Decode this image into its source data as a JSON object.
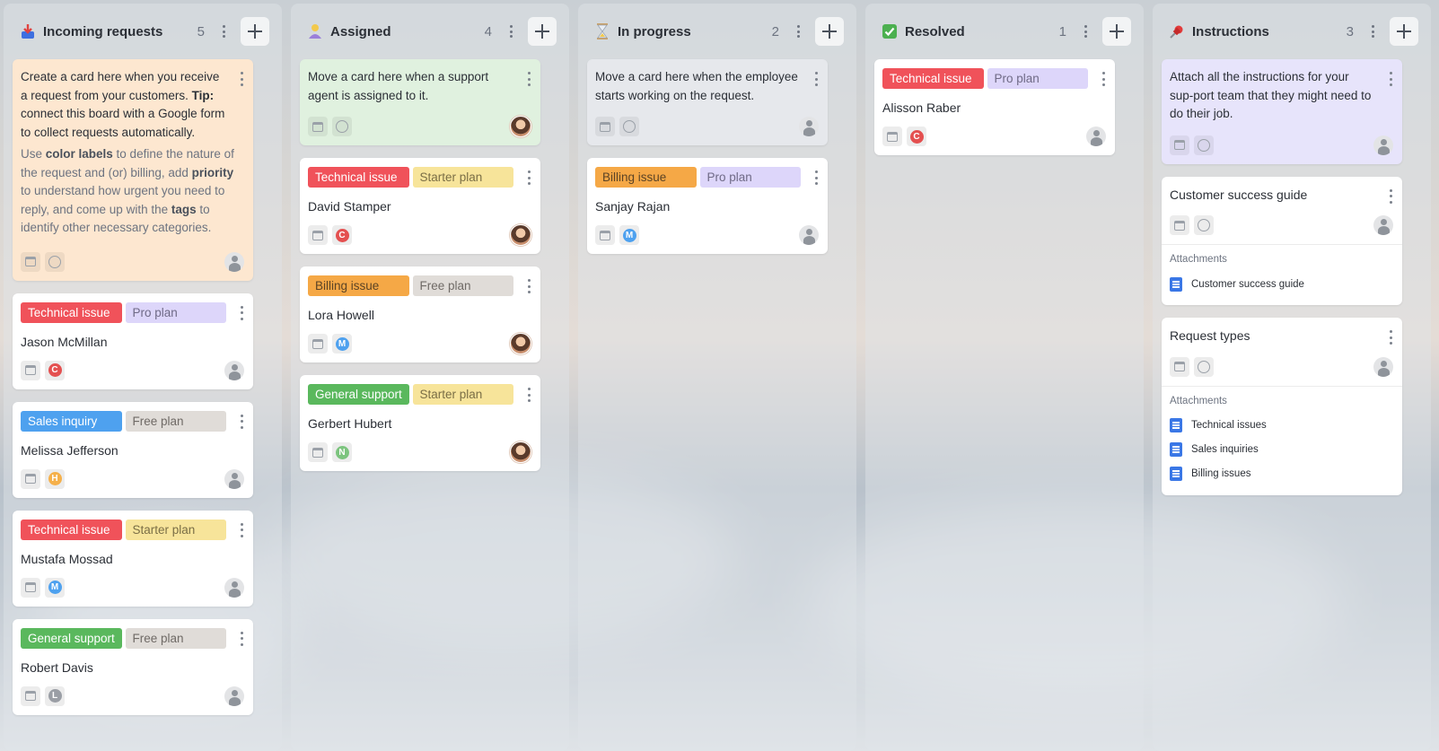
{
  "colors": {
    "technical": "#f0525a",
    "sales": "#4ea1ef",
    "billing": "#f5a846",
    "general": "#5ab85d",
    "pro": "#ddd6fa",
    "free": "#e0dcd8",
    "starter": "#f7e49a"
  },
  "columns": [
    {
      "title": "Incoming requests",
      "count": "5",
      "icon": "inbox-icon",
      "instruction": {
        "text_before": "Create a card here when you receive a request from your customers.",
        "tip_label": "Tip:",
        "tip_text": " connect this board with a Google form to collect requests automatically.",
        "sub": {
          "p1": "Use ",
          "b1": "color labels",
          "p2": " to define the nature of the request and (or) billing, add ",
          "b2": "priority",
          "p3": " to understand how urgent you need to reply, and come up with the ",
          "b3": "tags",
          "p4": " to identify other necessary categories."
        }
      },
      "cards": [
        {
          "label1": "Technical issue",
          "label2": "Pro plan",
          "name": "Jason McMillan",
          "letter": "C"
        },
        {
          "label1": "Sales inquiry",
          "label2": "Free plan",
          "name": "Melissa Jefferson",
          "letter": "H"
        },
        {
          "label1": "Technical issue",
          "label2": "Starter plan",
          "name": "Mustafa Mossad",
          "letter": "M"
        },
        {
          "label1": "General support",
          "label2": "Free plan",
          "name": "Robert Davis",
          "letter": "L"
        }
      ]
    },
    {
      "title": "Assigned",
      "count": "4",
      "icon": "person-icon",
      "instruction": {
        "text": "Move a card here when a support agent is assigned to it."
      },
      "cards": [
        {
          "label1": "Technical issue",
          "label2": "Starter plan",
          "name": "David Stamper",
          "letter": "C"
        },
        {
          "label1": "Billing issue",
          "label2": "Free plan",
          "name": "Lora Howell",
          "letter": "M"
        },
        {
          "label1": "General support",
          "label2": "Starter plan",
          "name": "Gerbert Hubert",
          "letter": "N"
        }
      ]
    },
    {
      "title": "In progress",
      "count": "2",
      "icon": "hourglass-icon",
      "instruction": {
        "text": "Move a card here when the employee starts  working on the request."
      },
      "cards": [
        {
          "label1": "Billing issue",
          "label2": "Pro plan",
          "name": "Sanjay Rajan",
          "letter": "M"
        }
      ]
    },
    {
      "title": "Resolved",
      "count": "1",
      "icon": "checkmark-icon",
      "cards": [
        {
          "label1": "Technical issue",
          "label2": "Pro plan",
          "name": "Alisson Raber",
          "letter": "C"
        }
      ]
    },
    {
      "title": "Instructions",
      "count": "3",
      "icon": "pin-icon",
      "instruction": {
        "text": "Attach all the instructions for your sup-port team that they might need to do their job."
      },
      "docs": [
        {
          "title": "Customer success guide",
          "attachments_label": "Attachments",
          "files": [
            "Customer success guide"
          ]
        },
        {
          "title": "Request types",
          "attachments_label": "Attachments",
          "files": [
            "Technical issues",
            "Sales inquiries",
            "Billing issues"
          ]
        }
      ]
    }
  ]
}
